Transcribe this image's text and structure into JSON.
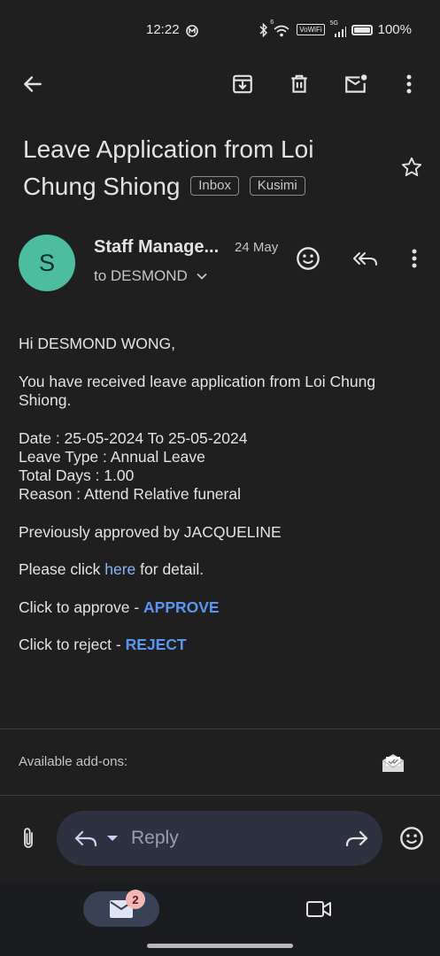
{
  "status_bar": {
    "time": "12:22",
    "battery": "100%",
    "volte": "VoWiFi",
    "net": "5G",
    "wifi_badge": "6"
  },
  "toolbar": {
    "icons": [
      "arrow-back-icon",
      "archive-icon",
      "delete-icon",
      "mark-unread-icon",
      "more-vert-icon"
    ]
  },
  "email": {
    "subject": "Leave Application from Loi Chung Shiong",
    "labels": [
      "Inbox",
      "Kusimi"
    ],
    "sender": {
      "avatar_letter": "S",
      "avatar_color": "#4dbd9f",
      "name": "Staff Manage...",
      "date": "24 May",
      "recipient": "to DESMOND"
    },
    "body": {
      "greeting": "Hi DESMOND WONG,",
      "intro": "You have received leave application from Loi Chung Shiong.",
      "date_line": "Date : 25-05-2024 To 25-05-2024",
      "type_line": "Leave Type : Annual Leave",
      "days_line": "Total Days : 1.00",
      "reason_line": "Reason : Attend Relative funeral",
      "approved_by": "Previously approved by JACQUELINE",
      "click_prefix": "Please click ",
      "click_link": "here",
      "click_suffix": " for detail.",
      "approve_prefix": "Click to approve - ",
      "approve_link": "APPROVE",
      "reject_prefix": "Click to reject - ",
      "reject_link": "REJECT"
    }
  },
  "addons": {
    "label": "Available add-ons:"
  },
  "reply_bar": {
    "placeholder": "Reply"
  },
  "bottom_nav": {
    "mail_badge": "2"
  },
  "colors": {
    "background": "#1f1f1f",
    "accent_link": "#8ab4f8",
    "action_link": "#5a96f0",
    "badge": "#f2b8b5"
  }
}
